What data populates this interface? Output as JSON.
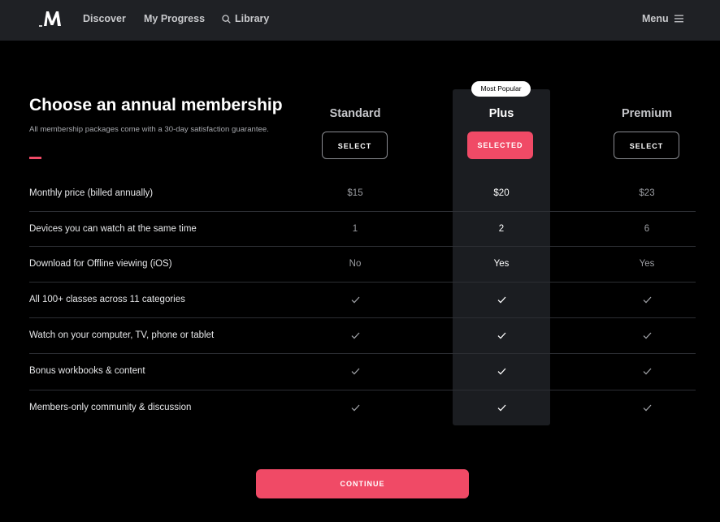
{
  "nav": {
    "discover": "Discover",
    "progress": "My Progress",
    "library": "Library",
    "menu": "Menu"
  },
  "page": {
    "title": "Choose an annual membership",
    "subtitle": "All membership packages come with a 30-day satisfaction guarantee.",
    "accent": "#f04a66"
  },
  "plans": {
    "standard": {
      "name": "Standard",
      "button": "SELECT",
      "name_color": "#c4c5c9"
    },
    "plus": {
      "name": "Plus",
      "button": "SELECTED",
      "badge": "Most Popular",
      "name_color": "#ffffff"
    },
    "premium": {
      "name": "Premium",
      "button": "SELECT",
      "name_color": "#c4c5c9"
    }
  },
  "features": [
    {
      "label": "Monthly price (billed annually)",
      "standard": "$15",
      "plus": "$20",
      "premium": "$23"
    },
    {
      "label": "Devices you can watch at the same time",
      "standard": "1",
      "plus": "2",
      "premium": "6"
    },
    {
      "label": "Download for Offline viewing (iOS)",
      "standard": "No",
      "plus": "Yes",
      "premium": "Yes"
    },
    {
      "label": "All 100+ classes across 11 categories",
      "standard": "check",
      "plus": "check",
      "premium": "check"
    },
    {
      "label": "Watch on your computer, TV, phone or tablet",
      "standard": "check",
      "plus": "check",
      "premium": "check"
    },
    {
      "label": "Bonus workbooks & content",
      "standard": "check",
      "plus": "check",
      "premium": "check"
    },
    {
      "label": "Members-only community & discussion",
      "standard": "check",
      "plus": "check",
      "premium": "check"
    }
  ],
  "continue_label": "CONTINUE",
  "icons": {
    "logo": "masterclass-logo-icon",
    "search": "search-icon",
    "menu": "hamburger-menu-icon",
    "check": "check-icon"
  }
}
